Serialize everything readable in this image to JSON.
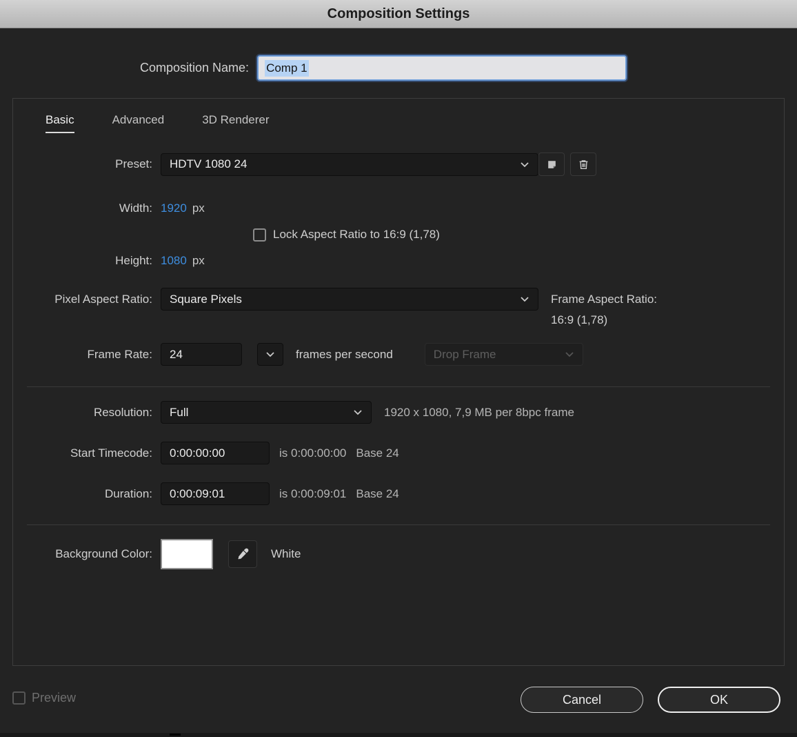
{
  "colors": {
    "accent_blue": "#3e8ee0",
    "swatch": "#ffffff"
  },
  "titlebar": {
    "title": "Composition Settings"
  },
  "name_row": {
    "label": "Composition Name:",
    "value": "Comp 1"
  },
  "tabs": {
    "basic": "Basic",
    "advanced": "Advanced",
    "renderer": "3D Renderer"
  },
  "preset": {
    "label": "Preset:",
    "value": "HDTV 1080 24"
  },
  "size": {
    "width_label": "Width:",
    "width_value": "1920",
    "width_unit": "px",
    "height_label": "Height:",
    "height_value": "1080",
    "height_unit": "px",
    "lock_label": "Lock Aspect Ratio to 16:9 (1,78)",
    "lock_checked": false
  },
  "pixel_aspect": {
    "label": "Pixel Aspect Ratio:",
    "value": "Square Pixels",
    "frame_aspect_label": "Frame Aspect Ratio:",
    "frame_aspect_value": "16:9 (1,78)"
  },
  "frame_rate": {
    "label": "Frame Rate:",
    "value": "24",
    "unit": "frames per second",
    "drop_frame_label": "Drop Frame"
  },
  "resolution": {
    "label": "Resolution:",
    "value": "Full",
    "info": "1920 x 1080, 7,9 MB per 8bpc frame"
  },
  "start_timecode": {
    "label": "Start Timecode:",
    "value": "0:00:00:00",
    "info_is": "is 0:00:00:00",
    "info_base": "Base 24"
  },
  "duration": {
    "label": "Duration:",
    "value": "0:00:09:01",
    "info_is": "is 0:00:09:01",
    "info_base": "Base 24"
  },
  "background": {
    "label": "Background Color:",
    "color": "#ffffff",
    "color_name": "White"
  },
  "footer": {
    "preview_label": "Preview",
    "cancel_label": "Cancel",
    "ok_label": "OK"
  },
  "icons": {
    "chevron_down": "chevron-down",
    "save_preset": "folded-square",
    "delete_preset": "trash",
    "eyedropper": "eyedropper"
  }
}
